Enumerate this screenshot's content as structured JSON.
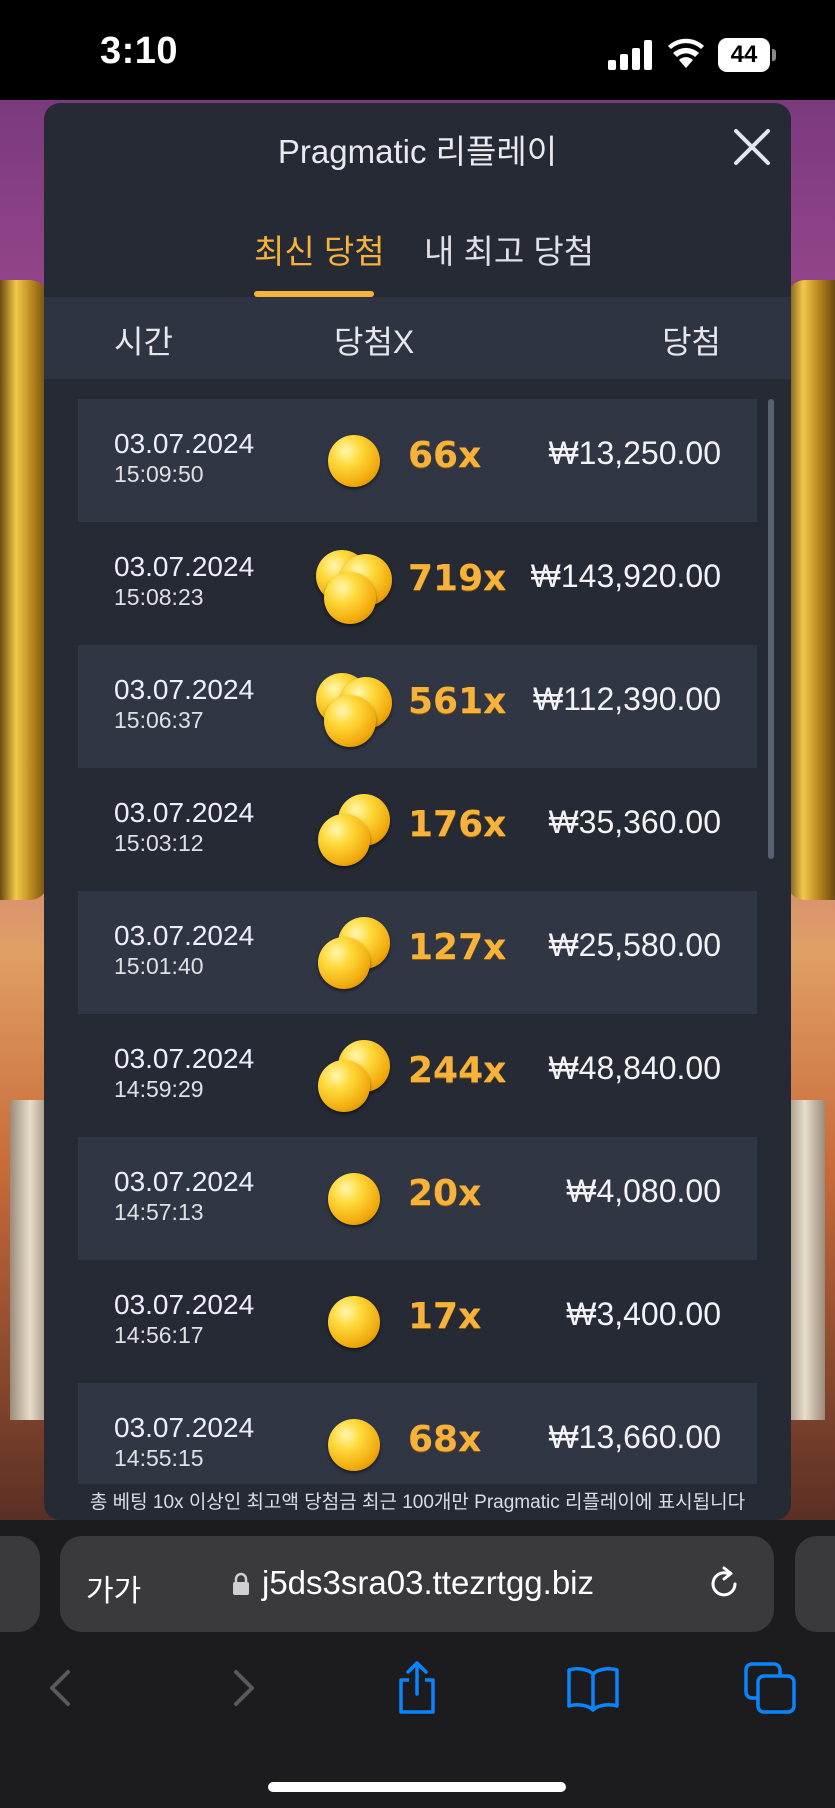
{
  "status_bar": {
    "time": "3:10",
    "battery": "44"
  },
  "modal": {
    "title": "Pragmatic 리플레이",
    "tabs": [
      {
        "label": "최신 당첨",
        "active": true
      },
      {
        "label": "내 최고 당첨",
        "active": false
      }
    ],
    "columns": {
      "time": "시간",
      "multiplier": "당첨X",
      "win": "당첨"
    },
    "rows": [
      {
        "date": "03.07.2024",
        "time": "15:09:50",
        "multiplier": "66x",
        "amount": "₩13,250.00",
        "coins": 1
      },
      {
        "date": "03.07.2024",
        "time": "15:08:23",
        "multiplier": "719x",
        "amount": "₩143,920.00",
        "coins": 3
      },
      {
        "date": "03.07.2024",
        "time": "15:06:37",
        "multiplier": "561x",
        "amount": "₩112,390.00",
        "coins": 3
      },
      {
        "date": "03.07.2024",
        "time": "15:03:12",
        "multiplier": "176x",
        "amount": "₩35,360.00",
        "coins": 2
      },
      {
        "date": "03.07.2024",
        "time": "15:01:40",
        "multiplier": "127x",
        "amount": "₩25,580.00",
        "coins": 2
      },
      {
        "date": "03.07.2024",
        "time": "14:59:29",
        "multiplier": "244x",
        "amount": "₩48,840.00",
        "coins": 2
      },
      {
        "date": "03.07.2024",
        "time": "14:57:13",
        "multiplier": "20x",
        "amount": "₩4,080.00",
        "coins": 1
      },
      {
        "date": "03.07.2024",
        "time": "14:56:17",
        "multiplier": "17x",
        "amount": "₩3,400.00",
        "coins": 1
      },
      {
        "date": "03.07.2024",
        "time": "14:55:15",
        "multiplier": "68x",
        "amount": "₩13,660.00",
        "coins": 1
      }
    ],
    "footnote": "총 베팅 10x 이상인 최고액 당첨금 최근 100개만 Pragmatic 리플레이에 표시됩니다"
  },
  "browser": {
    "text_size_label": "가가",
    "url": "j5ds3sra03.ttezrtgg.biz"
  },
  "colors": {
    "accent": "#f6b23a",
    "modal_bg": "#262a35",
    "row_shade": "#313645",
    "ios_blue": "#0a84ff"
  }
}
